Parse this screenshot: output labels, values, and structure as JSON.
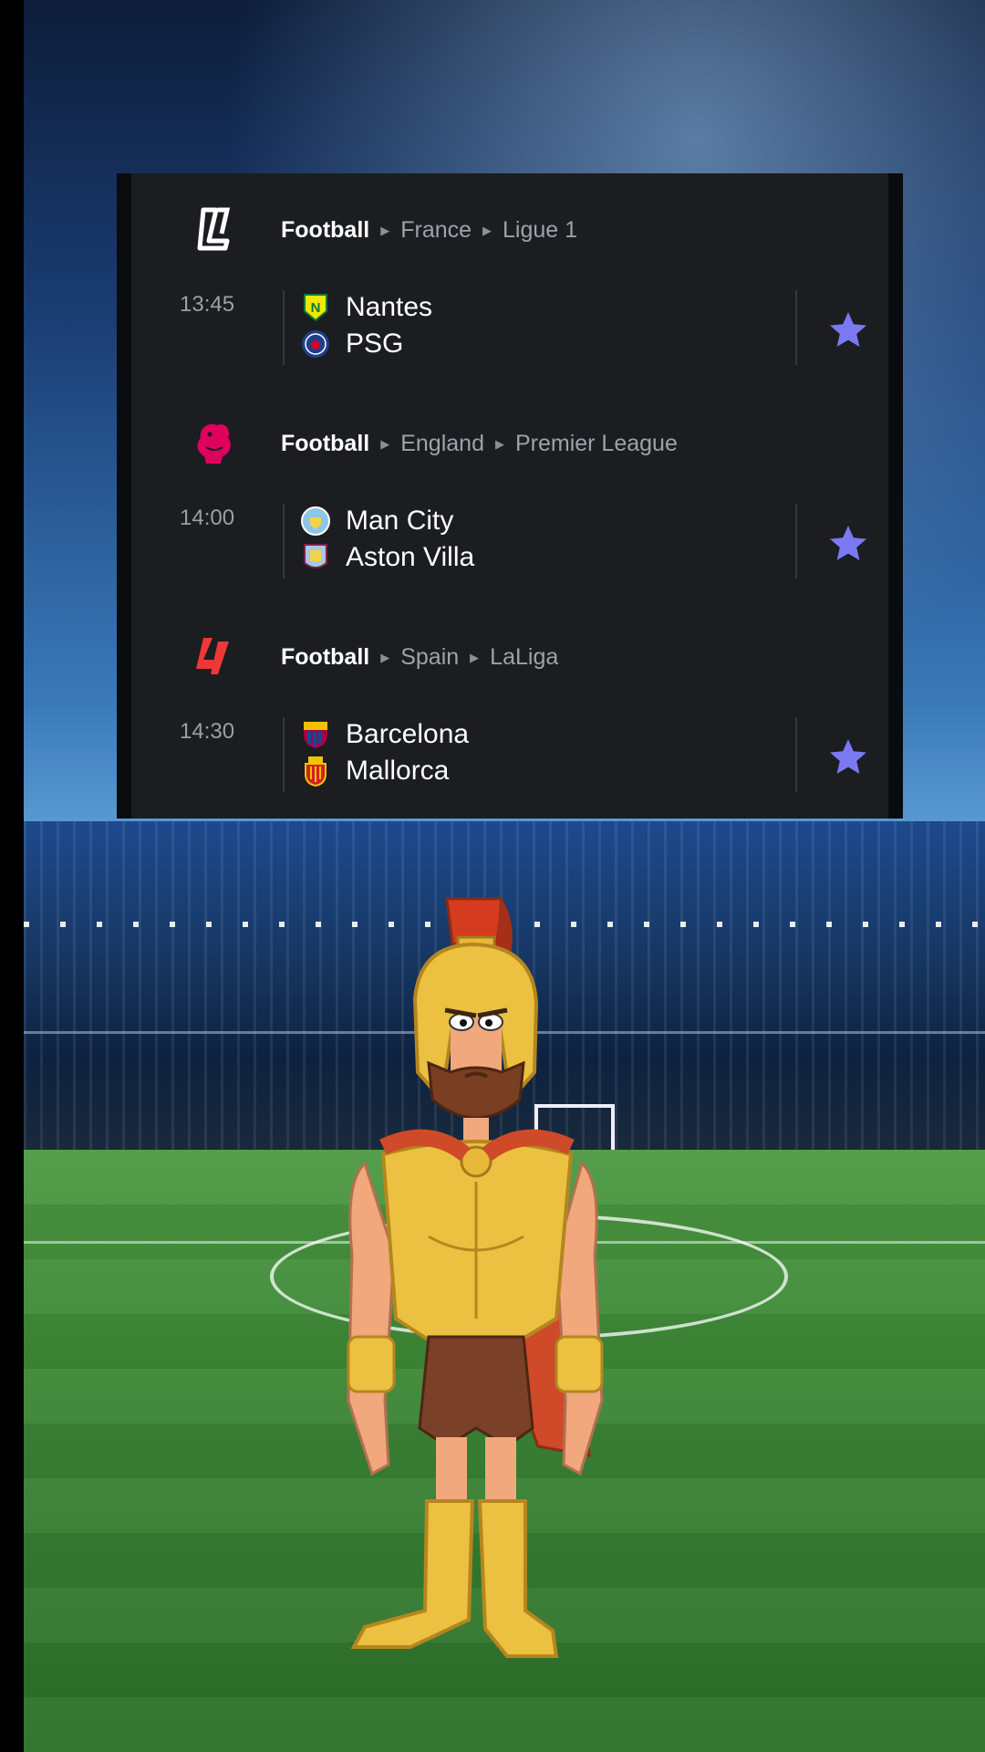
{
  "colors": {
    "card_background": "#1b1d21",
    "favourite_star": "#7b79f2",
    "ligue1_accent": "#ffffff",
    "premier_league_accent": "#e0005e",
    "laliga_accent": "#ee3737"
  },
  "matches": [
    {
      "league_icon": "ligue1-logo",
      "sport": "Football",
      "country": "France",
      "competition": "Ligue 1",
      "time": "13:45",
      "home": "Nantes",
      "away": "PSG",
      "home_icon": "nantes-crest",
      "away_icon": "psg-crest",
      "favourite_icon": "star-icon"
    },
    {
      "league_icon": "premier-league-logo",
      "sport": "Football",
      "country": "England",
      "competition": "Premier League",
      "time": "14:00",
      "home": "Man City",
      "away": "Aston Villa",
      "home_icon": "man-city-crest",
      "away_icon": "aston-villa-crest",
      "favourite_icon": "star-icon"
    },
    {
      "league_icon": "laliga-logo",
      "sport": "Football",
      "country": "Spain",
      "competition": "LaLiga",
      "time": "14:30",
      "home": "Barcelona",
      "away": "Mallorca",
      "home_icon": "barcelona-crest",
      "away_icon": "mallorca-crest",
      "favourite_icon": "star-icon"
    }
  ]
}
